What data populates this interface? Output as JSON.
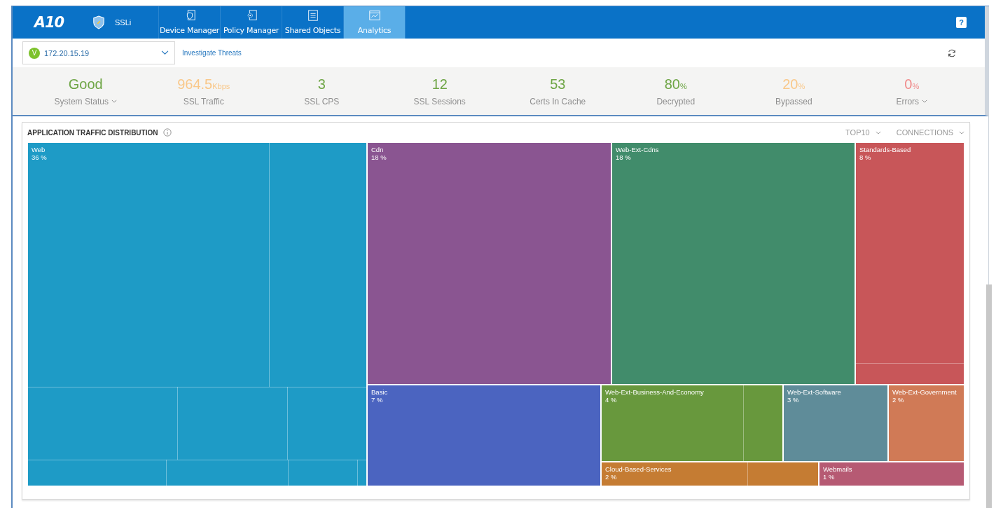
{
  "header": {
    "logo": "A10",
    "product": "SSLi",
    "tabs": [
      {
        "label": "Device Manager",
        "selected": false
      },
      {
        "label": "Policy Manager",
        "selected": false
      },
      {
        "label": "Shared Objects",
        "selected": false
      },
      {
        "label": "Analytics",
        "selected": true
      }
    ],
    "help": "?"
  },
  "toolbar": {
    "device": {
      "badge": "V",
      "address": "172.20.15.19"
    },
    "link": "Investigate Threats"
  },
  "stats": [
    {
      "value": "Good",
      "label": "System Status",
      "color": "#6ea545",
      "dropdown": true
    },
    {
      "value": "964.5",
      "unit": "Kbps",
      "label": "SSL Traffic",
      "color": "#f9c88a",
      "dropdown": false
    },
    {
      "value": "3",
      "label": "SSL CPS",
      "color": "#6ea545",
      "dropdown": false
    },
    {
      "value": "12",
      "label": "SSL Sessions",
      "color": "#6ea545",
      "dropdown": false
    },
    {
      "value": "53",
      "label": "Certs In Cache",
      "color": "#6ea545",
      "dropdown": false
    },
    {
      "value": "80",
      "unit": "%",
      "label": "Decrypted",
      "color": "#6ea545",
      "dropdown": false
    },
    {
      "value": "20",
      "unit": "%",
      "label": "Bypassed",
      "color": "#f9c88a",
      "dropdown": false
    },
    {
      "value": "0",
      "unit": "%",
      "label": "Errors",
      "color": "#f08a8a",
      "dropdown": true
    }
  ],
  "card": {
    "title": "APPLICATION TRAFFIC DISTRIBUTION",
    "filters": [
      "TOP10",
      "CONNECTIONS"
    ],
    "tiles": [
      {
        "name": "Web",
        "share": "36 %",
        "color": "#1e9bc6"
      },
      {
        "name": "Cdn",
        "share": "18 %",
        "color": "#8a5591"
      },
      {
        "name": "Web-Ext-Cdns",
        "share": "18 %",
        "color": "#418c6b"
      },
      {
        "name": "Standards-Based",
        "share": "8 %",
        "color": "#c85659"
      },
      {
        "name": "Basic",
        "share": "7 %",
        "color": "#4b64c0"
      },
      {
        "name": "Web-Ext-Business-And-Economy",
        "share": "4 %",
        "color": "#68983d"
      },
      {
        "name": "Web-Ext-Software",
        "share": "3 %",
        "color": "#5f8c99"
      },
      {
        "name": "Web-Ext-Government",
        "share": "2 %",
        "color": "#d07a56"
      },
      {
        "name": "Cloud-Based-Services",
        "share": "2 %",
        "color": "#c57c33"
      },
      {
        "name": "Webmails",
        "share": "1 %",
        "color": "#b65a73"
      }
    ]
  }
}
